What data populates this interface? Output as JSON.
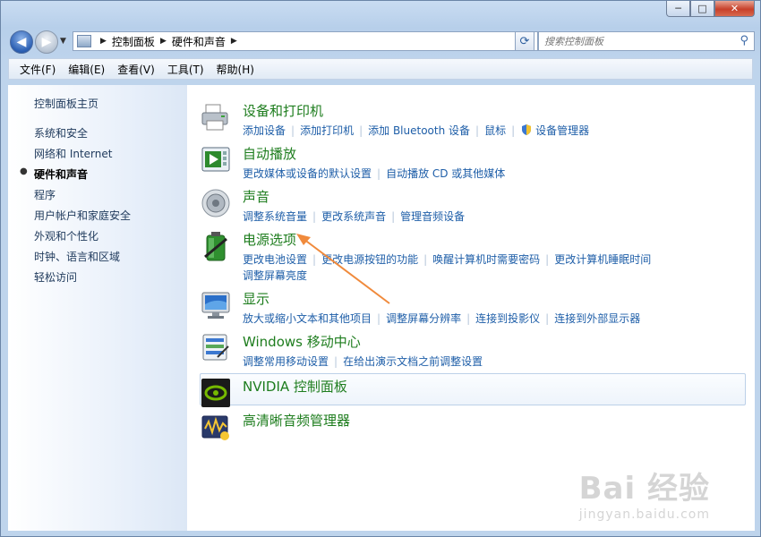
{
  "window": {
    "minimize": "─",
    "maximize": "□",
    "close": "✕"
  },
  "address": {
    "crumbs": [
      "控制面板",
      "硬件和声音"
    ]
  },
  "search": {
    "placeholder": "搜索控制面板"
  },
  "menu": [
    "文件(F)",
    "编辑(E)",
    "查看(V)",
    "工具(T)",
    "帮助(H)"
  ],
  "sidebar": {
    "home": "控制面板主页",
    "items": [
      "系统和安全",
      "网络和 Internet",
      "硬件和声音",
      "程序",
      "用户帐户和家庭安全",
      "外观和个性化",
      "时钟、语言和区域",
      "轻松访问"
    ],
    "active_index": 2
  },
  "categories": [
    {
      "title": "设备和打印机",
      "icon": "printer-icon",
      "links": [
        "添加设备",
        "添加打印机",
        "添加 Bluetooth 设备",
        "鼠标",
        "设备管理器"
      ]
    },
    {
      "title": "自动播放",
      "icon": "autoplay-icon",
      "links": [
        "更改媒体或设备的默认设置",
        "自动播放 CD 或其他媒体"
      ]
    },
    {
      "title": "声音",
      "icon": "speaker-icon",
      "links": [
        "调整系统音量",
        "更改系统声音",
        "管理音频设备"
      ]
    },
    {
      "title": "电源选项",
      "icon": "battery-icon",
      "links": [
        "更改电池设置",
        "更改电源按钮的功能",
        "唤醒计算机时需要密码",
        "更改计算机睡眠时间",
        "调整屏幕亮度"
      ]
    },
    {
      "title": "显示",
      "icon": "monitor-icon",
      "links": [
        "放大或缩小文本和其他项目",
        "调整屏幕分辨率",
        "连接到投影仪",
        "连接到外部显示器"
      ]
    },
    {
      "title": "Windows 移动中心",
      "icon": "mobility-center-icon",
      "links": [
        "调整常用移动设置",
        "在给出演示文档之前调整设置"
      ]
    },
    {
      "title": "NVIDIA 控制面板",
      "icon": "nvidia-icon",
      "links": []
    },
    {
      "title": "高清晰音频管理器",
      "icon": "audio-manager-icon",
      "links": []
    }
  ],
  "watermark": {
    "main": "Bai 经验",
    "sub": "jingyan.baidu.com"
  },
  "colors": {
    "title_green": "#1e7d1e",
    "link_blue": "#1e5ea8",
    "annotation_arrow": "#f08a3c"
  }
}
